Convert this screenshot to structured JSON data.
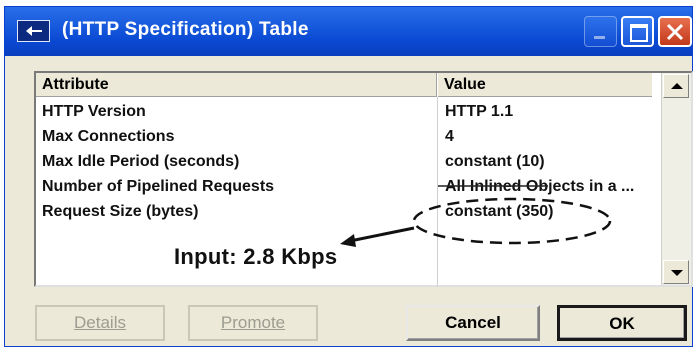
{
  "window": {
    "title": "(HTTP Specification) Table"
  },
  "table": {
    "columns": [
      "Attribute",
      "Value"
    ],
    "rows": [
      {
        "attribute": "HTTP Version",
        "value": "HTTP 1.1"
      },
      {
        "attribute": "Max Connections",
        "value": "4"
      },
      {
        "attribute": "Max Idle Period (seconds)",
        "value": "constant (10)"
      },
      {
        "attribute": "Number of Pipelined Requests",
        "value": "All Inlined Objects in a ..."
      },
      {
        "attribute": "Request Size (bytes)",
        "value": "constant (350)"
      }
    ]
  },
  "annotation": {
    "text": "Input: 2.8 Kbps"
  },
  "buttons": {
    "details": "Details",
    "promote": "Promote",
    "cancel": "Cancel",
    "ok": "OK"
  },
  "colors": {
    "titlebar": "#0a48d2",
    "close_button": "#c2391b",
    "dialog_face": "#ece9d8"
  }
}
